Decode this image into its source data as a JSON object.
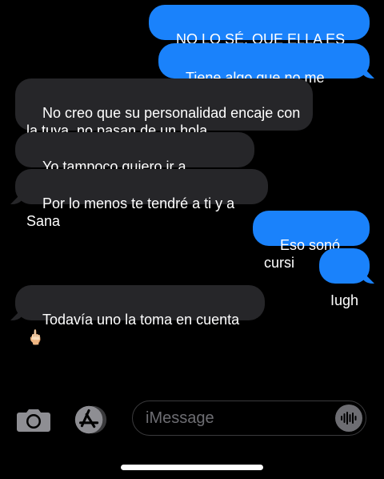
{
  "messages": [
    {
      "direction": "outgoing",
      "text": "NO LO SÉ, QUE ELLA ES RARA"
    },
    {
      "direction": "outgoing",
      "text": "Tiene algo que no me cuadra"
    },
    {
      "direction": "incoming",
      "text": "No creo que su personalidad encaje con la tuya, no pasan de un hola"
    },
    {
      "direction": "incoming",
      "text": "Yo tampoco quiero ir a presencial"
    },
    {
      "direction": "incoming",
      "text": "Por lo menos te tendré a ti y a Sana"
    },
    {
      "direction": "outgoing",
      "text": "Eso sonó cursi"
    },
    {
      "direction": "outgoing",
      "text": "Iugh"
    },
    {
      "direction": "incoming",
      "text": "Todavía uno la toma en cuenta 🖕🏻"
    }
  ],
  "composer": {
    "placeholder": "iMessage",
    "camera_icon": "camera-icon",
    "apps_icon": "app-store-icon",
    "audio_icon": "audio-waveform-icon"
  },
  "colors": {
    "background": "#000000",
    "outgoing_bubble": "#1a82fb",
    "incoming_bubble": "#262629",
    "placeholder": "#6d6d72"
  }
}
